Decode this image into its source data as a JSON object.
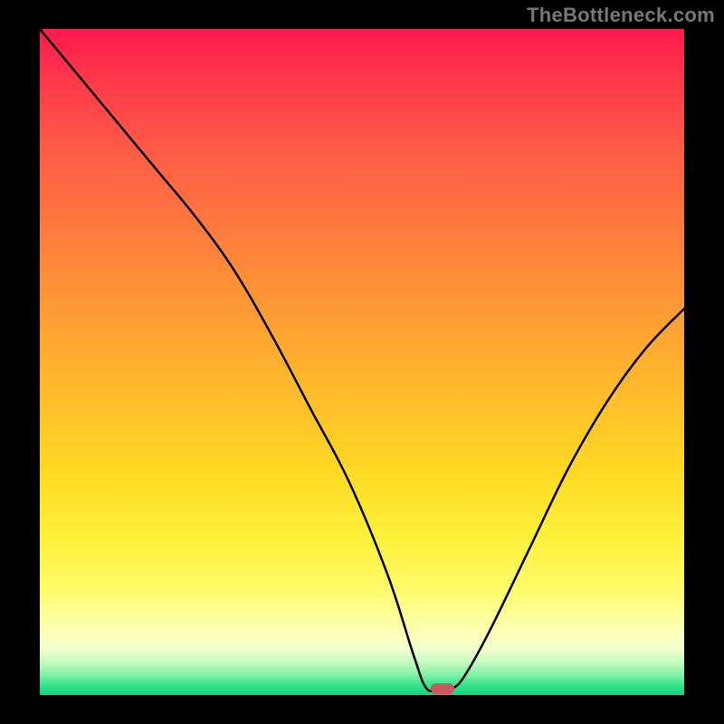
{
  "watermark": "TheBottleneck.com",
  "colors": {
    "frame_bg": "#000000",
    "curve_stroke": "#000000",
    "marker_fill": "#cf5860",
    "gradient_top": "#ff1a4d",
    "gradient_bottom": "#15d67c",
    "watermark_text": "#777777"
  },
  "chart_data": {
    "type": "line",
    "title": "",
    "xlabel": "",
    "ylabel": "",
    "xlim": [
      0,
      100
    ],
    "ylim": [
      0,
      100
    ],
    "grid": false,
    "legend": false,
    "annotations": [
      {
        "kind": "marker",
        "shape": "pill",
        "x": 62.5,
        "y": 1.0,
        "color": "#cf5860"
      }
    ],
    "series": [
      {
        "name": "bottleneck-curve",
        "x": [
          0,
          6,
          12,
          18,
          24,
          30,
          36,
          42,
          48,
          54,
          58,
          60,
          62,
          64,
          66,
          70,
          76,
          82,
          88,
          94,
          100
        ],
        "y": [
          100,
          93,
          86,
          79,
          72,
          64,
          54,
          43,
          32,
          18,
          6,
          1,
          1,
          1,
          3,
          10,
          22,
          34,
          44,
          52,
          58
        ]
      }
    ]
  }
}
